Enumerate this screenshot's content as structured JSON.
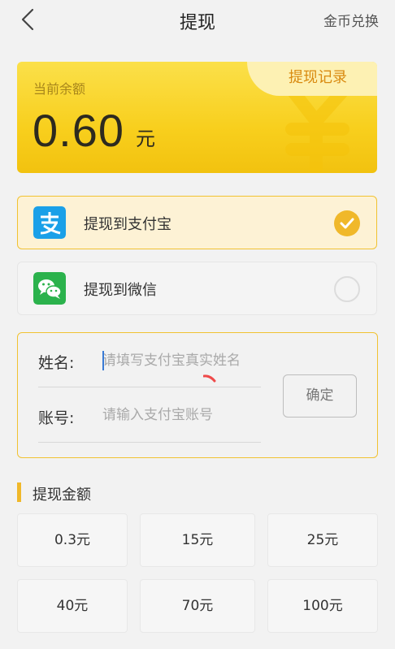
{
  "header": {
    "title": "提现",
    "right_link": "金币兑换"
  },
  "balance": {
    "label": "当前余额",
    "value": "0.60",
    "unit": "元",
    "record_button": "提现记录"
  },
  "payment_options": [
    {
      "label": "提现到支付宝",
      "icon": "alipay-icon",
      "selected": true
    },
    {
      "label": "提现到微信",
      "icon": "wechat-icon",
      "selected": false
    }
  ],
  "form": {
    "name_label": "姓名:",
    "name_placeholder": "请填写支付宝真实姓名",
    "account_label": "账号:",
    "account_placeholder": "请输入支付宝账号",
    "confirm_button": "确定"
  },
  "amount_section": {
    "title": "提现金额",
    "amounts": [
      "0.3元",
      "15元",
      "25元",
      "40元",
      "70元",
      "100元"
    ]
  },
  "colors": {
    "accent": "#f0b82a",
    "card_yellow": "#f8cf1d",
    "alipay_blue": "#1aa0e8",
    "wechat_green": "#2bb24c"
  }
}
